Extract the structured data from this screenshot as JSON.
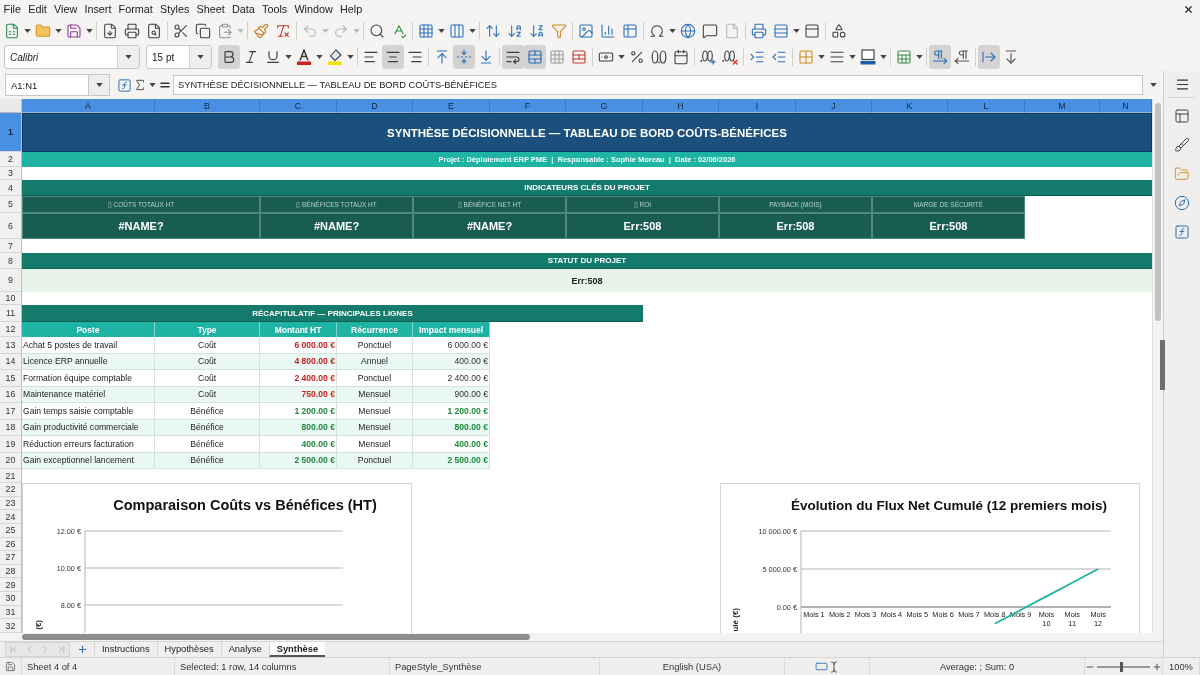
{
  "menu_bar": {
    "items": [
      "File",
      "Edit",
      "View",
      "Insert",
      "Format",
      "Styles",
      "Sheet",
      "Data",
      "Tools",
      "Window",
      "Help"
    ]
  },
  "standard_toolbar": {
    "undo_disabled": true,
    "redo_disabled": true
  },
  "formatting_toolbar": {
    "font_name": "Calibri",
    "font_size": "15 pt",
    "bold": true,
    "italic": false,
    "underline": false,
    "align_left": false,
    "align_center": true,
    "align_right": false,
    "align_top": false,
    "align_middle": true,
    "align_bottom": false,
    "wrap_text": true,
    "merge_and_center": true,
    "left_to_right": true,
    "right_to_left": false,
    "horizontal_text": true,
    "vertical_text": false
  },
  "formula_bar": {
    "name_box": "A1:N1",
    "content": "SYNTHÈSE DÉCISIONNELLE — TABLEAU DE BORD COÛTS-BÉNÉFICES"
  },
  "sheet": {
    "columns": [
      {
        "label": "A",
        "selected": true
      },
      {
        "label": "B",
        "selected": true
      },
      {
        "label": "C",
        "selected": true
      },
      {
        "label": "D",
        "selected": true
      },
      {
        "label": "E",
        "selected": true
      },
      {
        "label": "F",
        "selected": true
      },
      {
        "label": "G",
        "selected": true
      },
      {
        "label": "H",
        "selected": true
      },
      {
        "label": "I",
        "selected": true
      },
      {
        "label": "J",
        "selected": true
      },
      {
        "label": "K",
        "selected": true
      },
      {
        "label": "L",
        "selected": true
      },
      {
        "label": "M",
        "selected": true
      },
      {
        "label": "N",
        "selected": true
      }
    ],
    "rows": [
      {
        "label": "1",
        "selected": true
      },
      {
        "label": "2",
        "selected": false
      },
      {
        "label": "3",
        "selected": false
      },
      {
        "label": "4",
        "selected": false
      },
      {
        "label": "5",
        "selected": false
      },
      {
        "label": "6",
        "selected": false
      },
      {
        "label": "7",
        "selected": false
      },
      {
        "label": "8",
        "selected": false
      },
      {
        "label": "9",
        "selected": false
      },
      {
        "label": "10",
        "selected": false
      },
      {
        "label": "11",
        "selected": false
      },
      {
        "label": "12",
        "selected": false
      },
      {
        "label": "13",
        "selected": false
      },
      {
        "label": "14",
        "selected": false
      },
      {
        "label": "15",
        "selected": false
      },
      {
        "label": "16",
        "selected": false
      },
      {
        "label": "17",
        "selected": false
      },
      {
        "label": "18",
        "selected": false
      },
      {
        "label": "19",
        "selected": false
      },
      {
        "label": "20",
        "selected": false
      },
      {
        "label": "21",
        "selected": false
      },
      {
        "label": "22",
        "selected": false
      },
      {
        "label": "23",
        "selected": false
      },
      {
        "label": "24",
        "selected": false
      },
      {
        "label": "25",
        "selected": false
      },
      {
        "label": "26",
        "selected": false
      },
      {
        "label": "27",
        "selected": false
      },
      {
        "label": "28",
        "selected": false
      },
      {
        "label": "29",
        "selected": false
      },
      {
        "label": "30",
        "selected": false
      },
      {
        "label": "31",
        "selected": false
      },
      {
        "label": "32",
        "selected": false
      }
    ],
    "title": "SYNTHÈSE DÉCISIONNELLE — TABLEAU DE BORD COÛTS-BÉNÉFICES",
    "subtitle": "Projet : Déploiement ERP PME  |  Responsable : Sophie Moreau  |  Date : 02/06/2026",
    "indicators": {
      "heading": "INDICATEURS CLÉS DU PROJET",
      "items": [
        {
          "label": "▯ COÛTS TOTAUX HT",
          "value": "#NAME?"
        },
        {
          "label": "▯ BÉNÉFICES TOTAUX HT",
          "value": "#NAME?"
        },
        {
          "label": "▯ BÉNÉFICE NET HT",
          "value": "#NAME?"
        },
        {
          "label": "▯ ROI",
          "value": "Err:508"
        },
        {
          "label": "PAYBACK (MOIS)",
          "value": "Err:508"
        },
        {
          "label": "MARGE DE SÉCURITÉ",
          "value": "Err:508"
        }
      ]
    },
    "status": {
      "heading": "STATUT DU PROJET",
      "value": "Err:508"
    },
    "summary": {
      "heading": "RÉCAPITULATIF — PRINCIPALES LIGNES",
      "columns": [
        "Poste",
        "Type",
        "Montant HT",
        "Récurrence",
        "Impact mensuel"
      ],
      "rows": [
        {
          "kind": "cost",
          "poste": "Achat 5 postes de travail",
          "type": "Coût",
          "montant": "6 000.00 €",
          "recurrence": "Ponctuel",
          "impact": "6 000.00 €"
        },
        {
          "kind": "cost",
          "poste": "Licence ERP annuelle",
          "type": "Coût",
          "montant": "4 800.00 €",
          "recurrence": "Annuel",
          "impact": "400.00 €"
        },
        {
          "kind": "cost",
          "poste": "Formation équipe comptable",
          "type": "Coût",
          "montant": "2 400.00 €",
          "recurrence": "Ponctuel",
          "impact": "2 400.00 €"
        },
        {
          "kind": "cost",
          "poste": "Maintenance matériel",
          "type": "Coût",
          "montant": "750.00 €",
          "recurrence": "Mensuel",
          "impact": "900.00 €"
        },
        {
          "kind": "benefit",
          "poste": "Gain temps saisie comptable",
          "type": "Bénéfice",
          "montant": "1 200.00 €",
          "recurrence": "Mensuel",
          "impact": "1 200.00 €"
        },
        {
          "kind": "benefit",
          "poste": "Gain productivité commerciale",
          "type": "Bénéfice",
          "montant": "800.00 €",
          "recurrence": "Mensuel",
          "impact": "800.00 €"
        },
        {
          "kind": "benefit",
          "poste": "Réduction erreurs facturation",
          "type": "Bénéfice",
          "montant": "400.00 €",
          "recurrence": "Mensuel",
          "impact": "400.00 €"
        },
        {
          "kind": "benefit",
          "poste": "Gain exceptionnel lancement",
          "type": "Bénéfice",
          "montant": "2 500.00 €",
          "recurrence": "Ponctuel",
          "impact": "2 500.00 €"
        }
      ]
    },
    "charts": [
      {
        "chart_data": {
          "type": "bar",
          "title": "Comparaison Coûts vs Bénéfices (HT)",
          "ylabel": "(€)",
          "categories": [
            null,
            null
          ],
          "ylim": [
            6.5,
            12
          ],
          "yticks": [
            {
              "value": 8,
              "label": "8.00 €"
            },
            {
              "value": 10,
              "label": "10.00 €"
            },
            {
              "value": 12,
              "label": "12.00 €"
            }
          ]
        }
      },
      {
        "chart_data": {
          "type": "line",
          "title": "Évolution du Flux Net Cumulé (12 premiers mois)",
          "ylabel": "ulé (€)",
          "categories": [
            "Mois 1",
            "Mois 2",
            "Mois 3",
            "Mois 4",
            "Mois 5",
            "Mois 6",
            "Mois 7",
            "Mois 8",
            "Mois 9",
            "Mois 10",
            "Mois 11",
            "Mois 12"
          ],
          "series": [
            {
              "color": "#1fb3a3",
              "values": [
                null,
                null,
                null,
                null,
                null,
                null,
                null,
                -2200,
                -400,
                1400,
                3200,
                5000
              ]
            }
          ],
          "ylim": [
            -3500,
            10000
          ],
          "yticks": [
            {
              "value": 0,
              "label": "0.00 €"
            },
            {
              "value": 5000,
              "label": "5 000.00 €"
            },
            {
              "value": 10000,
              "label": "10 000.00 €"
            }
          ]
        }
      }
    ]
  },
  "sheet_tabs": [
    {
      "label": "Instructions",
      "selected": false
    },
    {
      "label": "Hypothèses",
      "selected": false
    },
    {
      "label": "Analyse",
      "selected": false
    },
    {
      "label": "Synthèse",
      "selected": true
    }
  ],
  "status_bar": {
    "sheet_position": "Sheet 4 of 4",
    "selection": "Selected: 1 row, 14 columns",
    "page_style": "PageStyle_Synthèse",
    "language": "English (USA)",
    "summary": "Average: ; Sum: 0",
    "zoom_slider": {
      "level": 0.45
    },
    "zoom": "100%"
  }
}
